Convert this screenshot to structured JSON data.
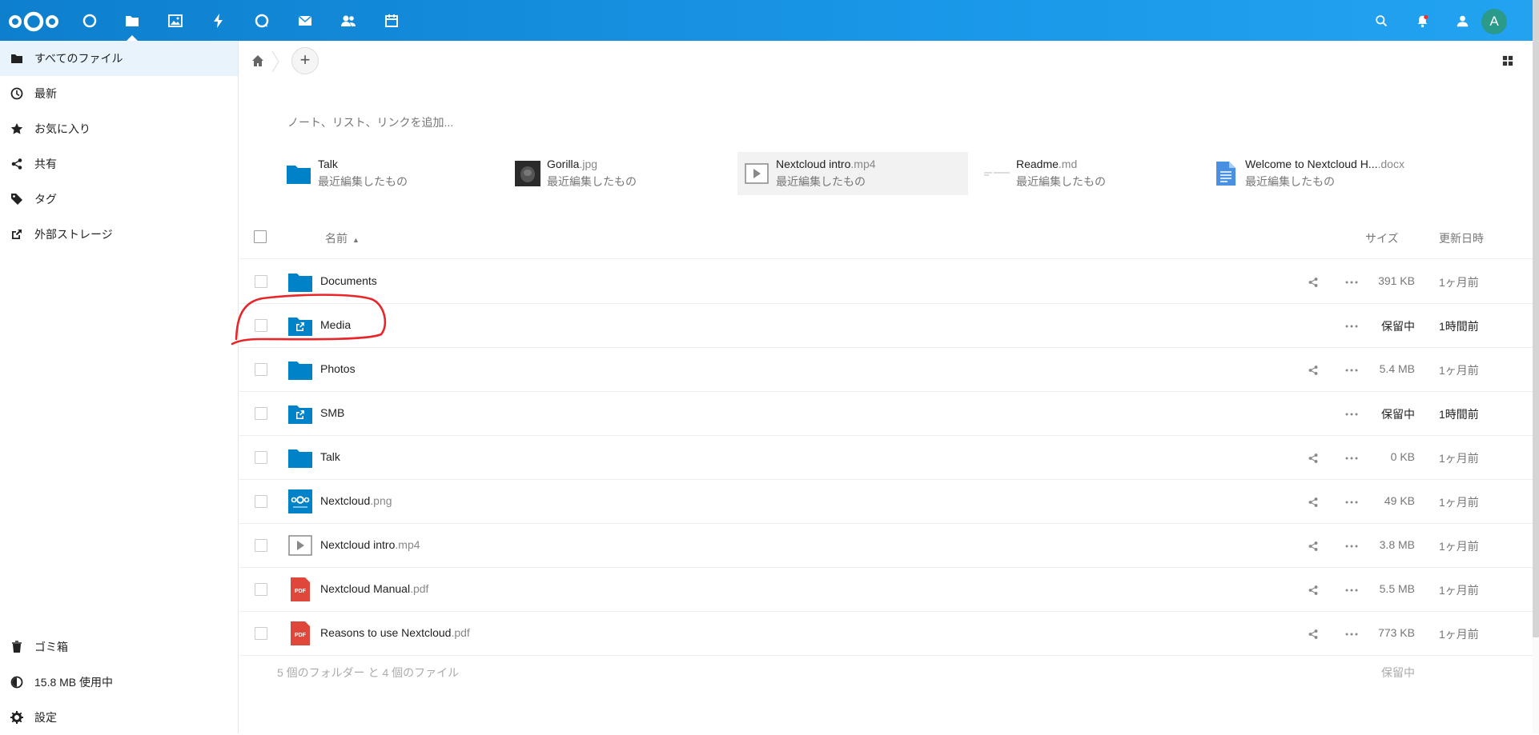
{
  "header": {
    "apps": [
      {
        "name": "dashboard-icon"
      },
      {
        "name": "files-icon"
      },
      {
        "name": "photos-icon"
      },
      {
        "name": "activity-icon"
      },
      {
        "name": "talk-icon"
      },
      {
        "name": "mail-icon"
      },
      {
        "name": "contacts-icon"
      },
      {
        "name": "calendar-icon"
      }
    ],
    "avatar_letter": "A"
  },
  "sidebar": {
    "items": [
      {
        "label": "すべてのファイル",
        "icon": "folder-icon"
      },
      {
        "label": "最新",
        "icon": "clock-icon"
      },
      {
        "label": "お気に入り",
        "icon": "star-icon"
      },
      {
        "label": "共有",
        "icon": "share-icon"
      },
      {
        "label": "タグ",
        "icon": "tag-icon"
      },
      {
        "label": "外部ストレージ",
        "icon": "external-link-icon"
      }
    ],
    "footer": {
      "trash": "ゴミ箱",
      "quota": "15.8 MB 使用中",
      "settings": "設定"
    }
  },
  "main": {
    "rich_workspace_placeholder": "ノート、リスト、リンクを追加...",
    "recent": [
      {
        "name": "Talk",
        "ext": "",
        "sub": "最近編集したもの",
        "thumb": "folder"
      },
      {
        "name": "Gorilla",
        "ext": ".jpg",
        "sub": "最近編集したもの",
        "thumb": "photo"
      },
      {
        "name": "Nextcloud intro",
        "ext": ".mp4",
        "sub": "最近編集したもの",
        "thumb": "video"
      },
      {
        "name": "Readme",
        "ext": ".md",
        "sub": "最近編集したもの",
        "thumb": "text"
      },
      {
        "name": "Welcome to Nextcloud H...",
        "ext": ".docx",
        "sub": "最近編集したもの",
        "thumb": "document"
      }
    ],
    "list_header": {
      "name": "名前",
      "size": "サイズ",
      "modified": "更新日時"
    },
    "files": [
      {
        "name": "Documents",
        "ext": "",
        "type": "folder",
        "size": "391 KB",
        "modified": "1ヶ月前",
        "shareable": true,
        "pending": false
      },
      {
        "name": "Media",
        "ext": "",
        "type": "external-folder",
        "size": "保留中",
        "modified": "1時間前",
        "shareable": false,
        "pending": true
      },
      {
        "name": "Photos",
        "ext": "",
        "type": "folder",
        "size": "5.4 MB",
        "modified": "1ヶ月前",
        "shareable": true,
        "pending": false
      },
      {
        "name": "SMB",
        "ext": "",
        "type": "external-folder",
        "size": "保留中",
        "modified": "1時間前",
        "shareable": false,
        "pending": true
      },
      {
        "name": "Talk",
        "ext": "",
        "type": "folder",
        "size": "0 KB",
        "modified": "1ヶ月前",
        "shareable": true,
        "pending": false
      },
      {
        "name": "Nextcloud",
        "ext": ".png",
        "type": "image",
        "size": "49 KB",
        "modified": "1ヶ月前",
        "shareable": true,
        "pending": false
      },
      {
        "name": "Nextcloud intro",
        "ext": ".mp4",
        "type": "video",
        "size": "3.8 MB",
        "modified": "1ヶ月前",
        "shareable": true,
        "pending": false
      },
      {
        "name": "Nextcloud Manual",
        "ext": ".pdf",
        "type": "pdf",
        "size": "5.5 MB",
        "modified": "1ヶ月前",
        "shareable": true,
        "pending": false
      },
      {
        "name": "Reasons to use Nextcloud",
        "ext": ".pdf",
        "type": "pdf",
        "size": "773 KB",
        "modified": "1ヶ月前",
        "shareable": true,
        "pending": false
      }
    ],
    "summary": {
      "text": "5 個のフォルダー と 4 個のファイル",
      "size": "保留中"
    }
  }
}
